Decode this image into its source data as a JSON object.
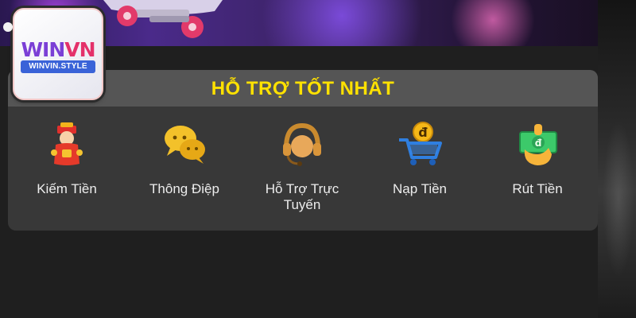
{
  "logo": {
    "brand_part1": "WIN",
    "brand_part2": "VN",
    "domain": "WINVIN.STYLE"
  },
  "panel": {
    "title": "HỖ TRỢ TỐT NHẤT",
    "items": [
      {
        "label": "Kiếm Tiền",
        "icon": "god-of-wealth-icon"
      },
      {
        "label": "Thông Điệp",
        "icon": "chat-bubbles-icon"
      },
      {
        "label": "Hỗ Trợ Trực\nTuyến",
        "icon": "headset-icon"
      },
      {
        "label": "Nạp Tiền",
        "icon": "shopping-cart-coin-icon"
      },
      {
        "label": "Rút Tiền",
        "icon": "cash-in-hand-icon"
      }
    ]
  },
  "colors": {
    "title": "#ffe100",
    "panel_bg": "#383838",
    "header_bg": "#555555",
    "page_bg": "#1f1f1f"
  }
}
